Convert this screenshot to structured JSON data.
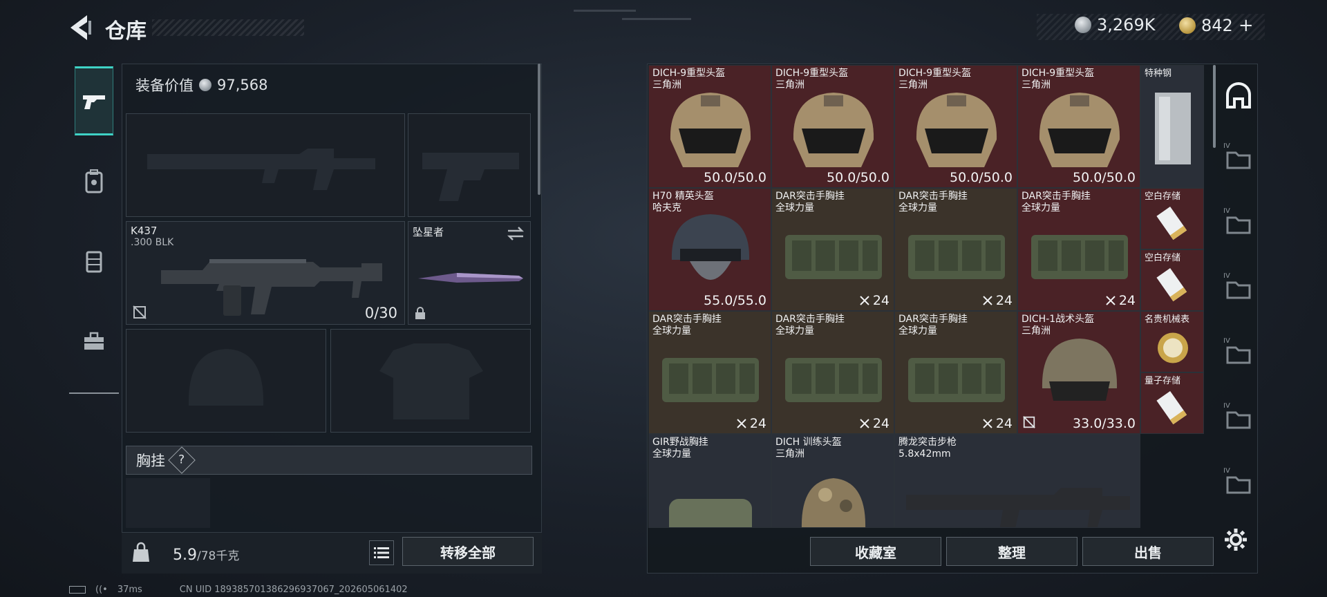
{
  "header": {
    "title": "仓库",
    "currency_silver": "3,269K",
    "currency_gold": "842",
    "gold_add": "+"
  },
  "left_rail": {
    "items": [
      {
        "icon": "pistol-icon",
        "active": true
      },
      {
        "icon": "backpack-icon",
        "active": false
      },
      {
        "icon": "vest-icon",
        "active": false
      },
      {
        "icon": "toolbox-icon",
        "active": false
      }
    ]
  },
  "loadout": {
    "equip_value_label": "装备价值",
    "equip_value": "97,568",
    "primary_weapon": {
      "name": "K437",
      "ammo_type": ".300 BLK",
      "ammo": "0/30"
    },
    "melee": {
      "name": "坠星者"
    },
    "chest_rig_label": "胸挂",
    "chest_rig_help": "?",
    "weight_current": "5.9",
    "weight_max": "/78千克",
    "transfer_all": "转移全部"
  },
  "stash": {
    "items": [
      {
        "name": "DICH-9重型头盔",
        "sub": "三角洲",
        "value": "50.0/50.0",
        "bg": "red",
        "kind": "helmet-tan"
      },
      {
        "name": "DICH-9重型头盔",
        "sub": "三角洲",
        "value": "50.0/50.0",
        "bg": "red",
        "kind": "helmet-tan"
      },
      {
        "name": "DICH-9重型头盔",
        "sub": "三角洲",
        "value": "50.0/50.0",
        "bg": "red",
        "kind": "helmet-tan"
      },
      {
        "name": "DICH-9重型头盔",
        "sub": "三角洲",
        "value": "50.0/50.0",
        "bg": "red",
        "kind": "helmet-tan"
      },
      {
        "name": "特种钢",
        "sub": "",
        "value": "",
        "bg": "neutral",
        "kind": "steel"
      },
      {
        "name": "H70 精英头盔",
        "sub": "哈夫克",
        "value": "55.0/55.0",
        "bg": "red",
        "kind": "helmet-dark"
      },
      {
        "name": "DAR突击手胸挂",
        "sub": "全球力量",
        "value": "24",
        "bg": "olive",
        "kind": "rig"
      },
      {
        "name": "DAR突击手胸挂",
        "sub": "全球力量",
        "value": "24",
        "bg": "olive",
        "kind": "rig"
      },
      {
        "name": "DAR突击手胸挂",
        "sub": "全球力量",
        "value": "24",
        "bg": "red",
        "kind": "rig"
      },
      {
        "name": "空白存储",
        "sub": "",
        "value": "",
        "bg": "red",
        "kind": "card"
      },
      {
        "name": "空白存储",
        "sub": "",
        "value": "",
        "bg": "red",
        "kind": "card"
      },
      {
        "name": "DAR突击手胸挂",
        "sub": "全球力量",
        "value": "24",
        "bg": "olive",
        "kind": "rig"
      },
      {
        "name": "DAR突击手胸挂",
        "sub": "全球力量",
        "value": "24",
        "bg": "olive",
        "kind": "rig"
      },
      {
        "name": "DAR突击手胸挂",
        "sub": "全球力量",
        "value": "24",
        "bg": "olive",
        "kind": "rig"
      },
      {
        "name": "DICH-1战术头盔",
        "sub": "三角洲",
        "value": "33.0/33.0",
        "bg": "red",
        "kind": "helmet-olive"
      },
      {
        "name": "名贵机械表",
        "sub": "",
        "value": "",
        "bg": "red",
        "kind": "watch"
      },
      {
        "name": "量子存储",
        "sub": "",
        "value": "",
        "bg": "red",
        "kind": "card"
      },
      {
        "name": "GIR野战胸挂",
        "sub": "全球力量",
        "value": "",
        "bg": "neutral",
        "kind": "rig-small"
      },
      {
        "name": "DICH 训练头盔",
        "sub": "三角洲",
        "value": "",
        "bg": "neutral",
        "kind": "helmet-camo"
      },
      {
        "name": "腾龙突击步枪",
        "sub": "5.8x42mm",
        "value": "",
        "bg": "neutral",
        "kind": "rifle"
      }
    ]
  },
  "actions": {
    "collection": "收藏室",
    "sort": "整理",
    "sell": "出售"
  },
  "right_rail": {
    "items": [
      {
        "icon": "stash-tab-icon",
        "badge": ""
      },
      {
        "icon": "folder-tab-icon",
        "badge": "IV"
      },
      {
        "icon": "folder-tab-icon",
        "badge": "IV"
      },
      {
        "icon": "folder-tab-icon",
        "badge": "IV"
      },
      {
        "icon": "folder-tab-icon",
        "badge": "IV"
      },
      {
        "icon": "folder-tab-icon",
        "badge": "IV"
      },
      {
        "icon": "folder-tab-icon",
        "badge": "IV"
      }
    ]
  },
  "status": {
    "ping": "37ms",
    "uid": "CN UID 1893857013862969370​67_202605061402"
  }
}
